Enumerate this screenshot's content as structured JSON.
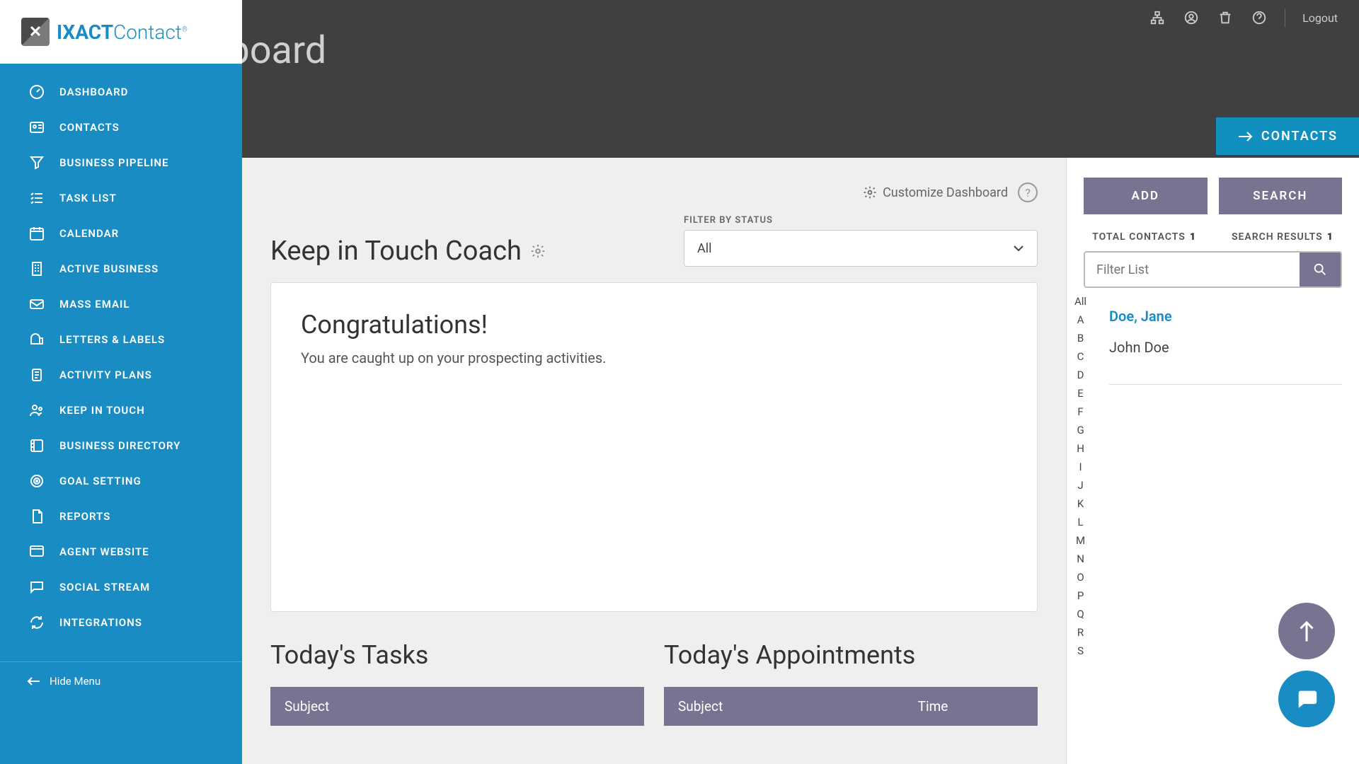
{
  "brand": {
    "name_a": "IXACT",
    "name_b": "Contact",
    "mark": "✕"
  },
  "header": {
    "title": "Dashboard"
  },
  "topbar": {
    "logout": "Logout"
  },
  "nav": {
    "items": [
      {
        "label": "DASHBOARD"
      },
      {
        "label": "CONTACTS"
      },
      {
        "label": "BUSINESS PIPELINE"
      },
      {
        "label": "TASK LIST"
      },
      {
        "label": "CALENDAR"
      },
      {
        "label": "ACTIVE BUSINESS"
      },
      {
        "label": "MASS EMAIL"
      },
      {
        "label": "LETTERS & LABELS"
      },
      {
        "label": "ACTIVITY PLANS"
      },
      {
        "label": "KEEP IN TOUCH"
      },
      {
        "label": "BUSINESS DIRECTORY"
      },
      {
        "label": "GOAL SETTING"
      },
      {
        "label": "REPORTS"
      },
      {
        "label": "AGENT WEBSITE"
      },
      {
        "label": "SOCIAL STREAM"
      },
      {
        "label": "INTEGRATIONS"
      }
    ],
    "hide": "Hide Menu"
  },
  "contacts_tab": "CONTACTS",
  "customize": {
    "label": "Customize Dashboard"
  },
  "coach": {
    "title": "Keep in Touch Coach",
    "filter_label": "FILTER BY STATUS",
    "filter_value": "All",
    "congrats": "Congratulations!",
    "sub": "You are caught up on your prospecting activities."
  },
  "lower": {
    "tasks_title": "Today's Tasks",
    "tasks_cols": [
      "Subject"
    ],
    "appts_title": "Today's Appointments",
    "appts_cols": [
      "Subject",
      "Time"
    ]
  },
  "panel": {
    "add": "ADD",
    "search": "SEARCH",
    "total_label": "TOTAL CONTACTS",
    "total_val": "1",
    "results_label": "SEARCH RESULTS",
    "results_val": "1",
    "placeholder": "Filter List",
    "alpha": [
      "All",
      "A",
      "B",
      "C",
      "D",
      "E",
      "F",
      "G",
      "H",
      "I",
      "J",
      "K",
      "L",
      "M",
      "N",
      "O",
      "P",
      "Q",
      "R",
      "S"
    ],
    "contacts": [
      {
        "display": "Doe, Jane",
        "selected": true
      },
      {
        "display": "John Doe",
        "selected": false
      }
    ]
  }
}
